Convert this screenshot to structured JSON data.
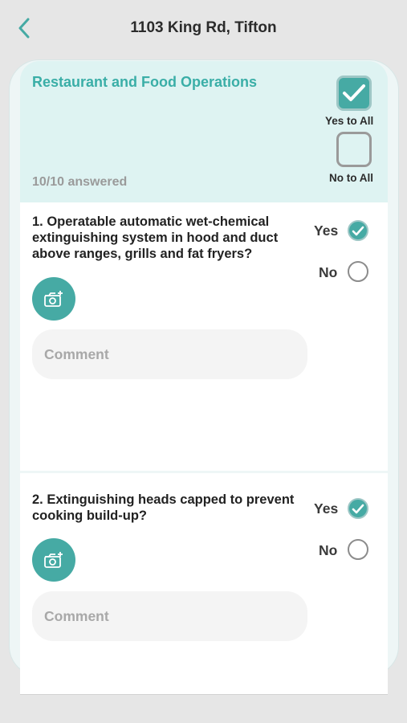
{
  "header": {
    "title": "1103 King Rd, Tifton",
    "back_icon": "chevron-left-icon"
  },
  "section": {
    "title": "Restaurant and Food Operations",
    "answered": "10/10 answered",
    "yes_to_all_label": "Yes to All",
    "yes_to_all_checked": true,
    "no_to_all_label": "No to All",
    "no_to_all_checked": false
  },
  "questions": [
    {
      "text": "1. Operatable automatic wet-chemical extinguishing system in hood and duct above ranges, grills and fat fryers?",
      "yes_label": "Yes",
      "no_label": "No",
      "answer": "Yes",
      "comment_placeholder": "Comment",
      "comment_value": ""
    },
    {
      "text": "2. Extinguishing heads capped to prevent cooking build-up?",
      "yes_label": "Yes",
      "no_label": "No",
      "answer": "Yes",
      "comment_placeholder": "Comment",
      "comment_value": ""
    }
  ],
  "colors": {
    "accent": "#46aaa4",
    "section_title": "#3aaea7",
    "section_bg": "#def3f2"
  }
}
